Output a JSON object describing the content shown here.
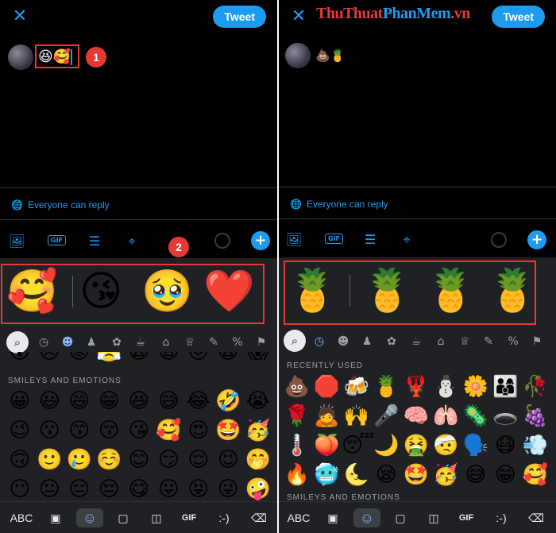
{
  "left": {
    "tweet_label": "Tweet",
    "compose_text": "😆🥰",
    "marker1": "1",
    "marker2": "2",
    "reply_label": "Everyone can reply",
    "stickers": [
      "🥰",
      "😘",
      "🥹",
      "❤️"
    ],
    "section_label": "SMILEYS AND EMOTIONS",
    "partial_row": [
      "😲",
      "😠",
      "😡",
      "😤",
      "😫",
      "😩",
      "😖",
      "😨",
      "😱"
    ],
    "emojis": [
      "😀",
      "😃",
      "😄",
      "😁",
      "😆",
      "😅",
      "😂",
      "🤣",
      "😭",
      "😉",
      "😗",
      "😙",
      "😚",
      "😘",
      "🥰",
      "😍",
      "🤩",
      "🥳",
      "🙃",
      "🙂",
      "🥲",
      "☺️",
      "😊",
      "😏",
      "😌",
      "😉",
      "🤭",
      "😶",
      "😐",
      "😑",
      "😔",
      "😋",
      "😛",
      "😝",
      "😜",
      "🤪"
    ]
  },
  "right": {
    "tweet_label": "Tweet",
    "compose_text": "💩🍍",
    "reply_label": "Everyone can reply",
    "stickers": [
      "🍍",
      "🍍",
      "🍍",
      "🍍"
    ],
    "section_label": "RECENTLY USED",
    "section_label2": "SMILEYS AND EMOTIONS",
    "emojis": [
      "💩",
      "🛑",
      "🍻",
      "🍍",
      "🦞",
      "⛄",
      "🌼",
      "👨‍👩‍👦",
      "🥀",
      "🌹",
      "🙇",
      "🙌",
      "🎤",
      "🧠",
      "🫁",
      "🦠",
      "🕳️",
      "🍇",
      "🌡️",
      "🍑",
      "😴",
      "🌙",
      "🤮",
      "🤕",
      "🗣️",
      "😷",
      "💨",
      "🔥",
      "🥶",
      "🌜",
      "😪",
      "🤩",
      "🥳",
      "😅",
      "😁",
      "🥰"
    ]
  },
  "keyboard": {
    "abc_label": "ABC",
    "gif_label": "GIF",
    "emoticon_label": ":-)"
  },
  "watermark": {
    "part1": "ThuThuat",
    "part2": "PhanMem",
    "part3": ".vn"
  },
  "colors": {
    "accent": "#1d9bf0",
    "highlight": "#e53935",
    "keyboard_bg": "#202124"
  }
}
